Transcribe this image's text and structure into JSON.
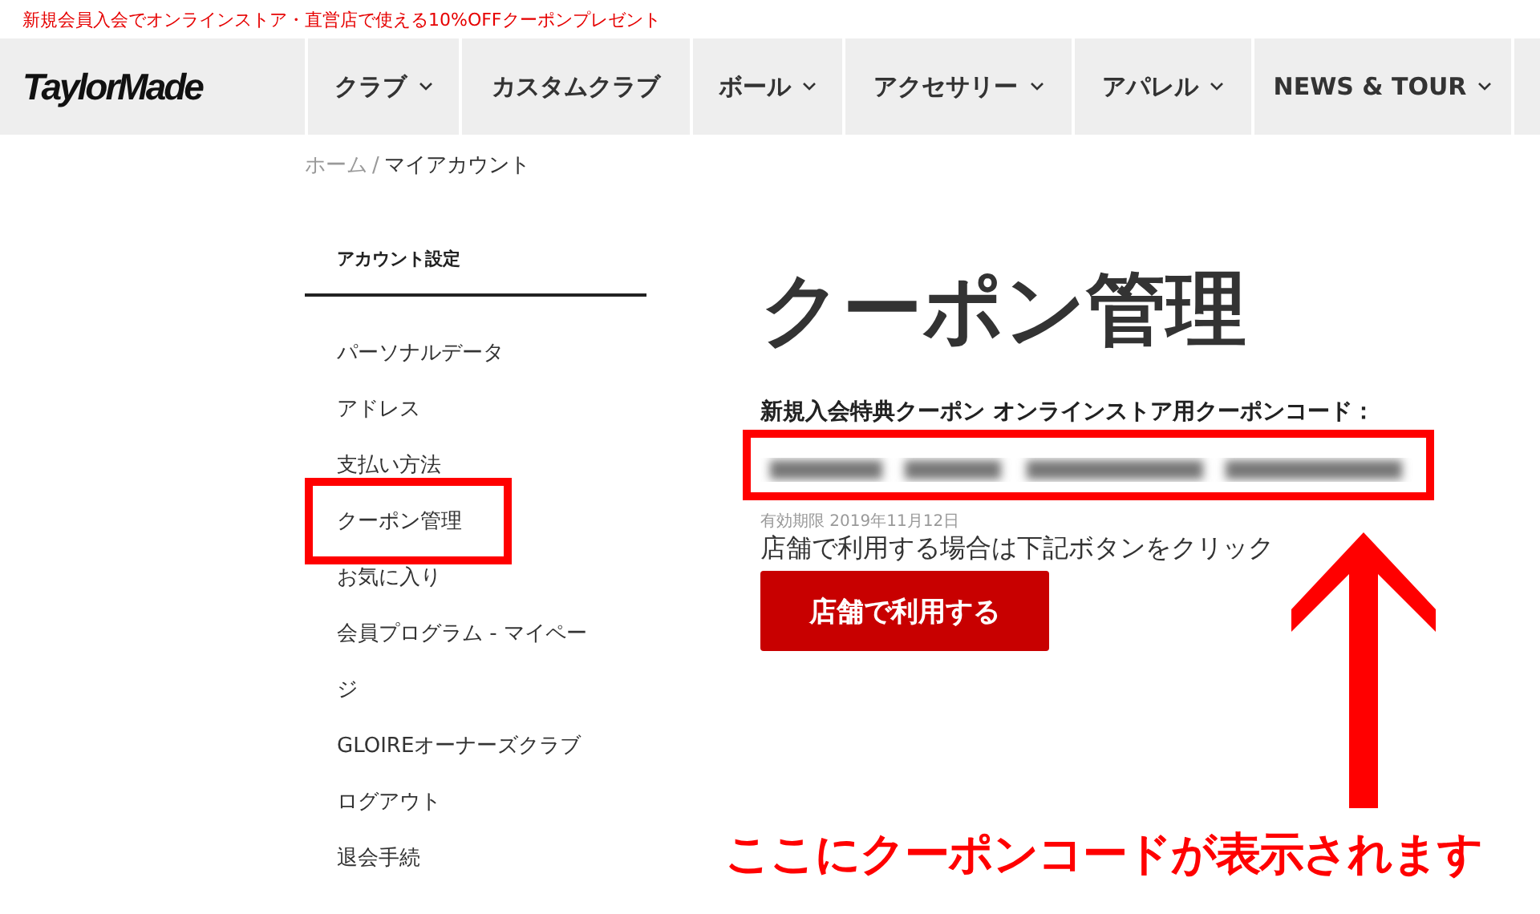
{
  "logo": "TaylorMade",
  "promo_banner": "新規会員入会でオンラインストア・直営店で使える10%OFFクーポンプレゼント",
  "nav": {
    "items": [
      {
        "label": "クラブ",
        "has_dropdown": true
      },
      {
        "label": "カスタムクラブ",
        "has_dropdown": false
      },
      {
        "label": "ボール",
        "has_dropdown": true
      },
      {
        "label": "アクセサリー",
        "has_dropdown": true
      },
      {
        "label": "アパレル",
        "has_dropdown": true
      },
      {
        "label": "NEWS & TOUR",
        "has_dropdown": true
      }
    ]
  },
  "breadcrumb": {
    "items": [
      "ホーム",
      "マイアカウント"
    ],
    "separator": "/"
  },
  "sidebar": {
    "heading": "アカウント設定",
    "items": [
      "パーソナルデータ",
      "アドレス",
      "支払い方法",
      "クーポン管理",
      "お気に入り",
      "会員プログラム - マイページ",
      "GLOIREオーナーズクラブ",
      "ログアウト",
      "退会手続"
    ]
  },
  "main": {
    "title": "クーポン管理",
    "coupon_label": "新規入会特典クーポン オンラインストア用クーポンコード：",
    "expiry": "有効期限 2019年11月12日",
    "instruction": "店舗で利用する場合は下記ボタンをクリック",
    "button": "店舗で利用する"
  },
  "annotation": {
    "caption": "ここにクーポンコードが表示されます"
  }
}
